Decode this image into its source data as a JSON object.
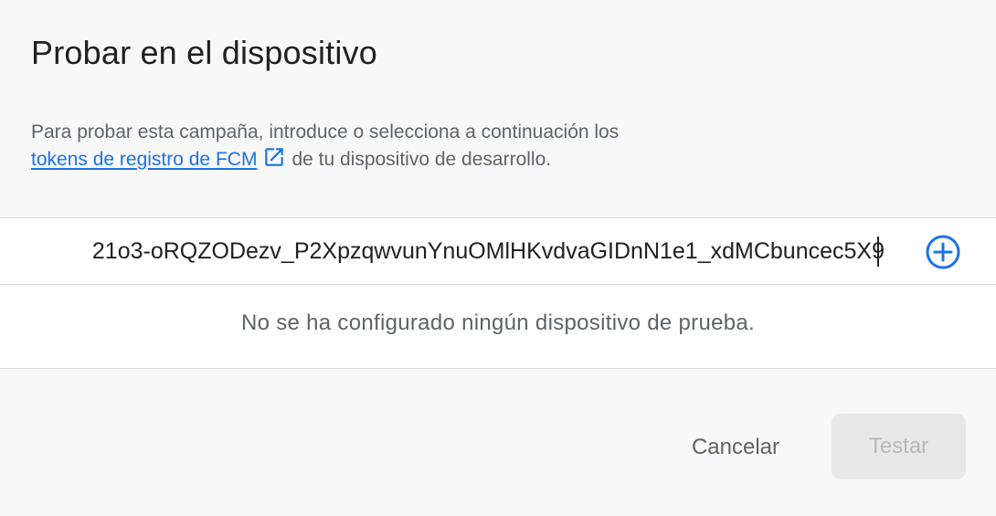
{
  "dialog": {
    "title": "Probar en el dispositivo",
    "description_before_link": "Para probar esta campaña, introduce o selecciona a continuación los",
    "link_text": "tokens de registro de FCM",
    "description_after_link": "de tu dispositivo de desarrollo.",
    "link_icon": "open-in-new-icon"
  },
  "token_field": {
    "visible_value": "21o3-oRQZODezv_P2XpzqwvunYnuOMlHKvdvaGIDnN1e1_xdMCbuncec5X9",
    "add_icon": "add-circle-icon"
  },
  "empty_state": {
    "message": "No se ha configurado ningún dispositivo de prueba."
  },
  "actions": {
    "cancel_label": "Cancelar",
    "test_label": "Testar",
    "test_disabled": true
  },
  "colors": {
    "link": "#1a73e8",
    "add_icon": "#1a73e8",
    "background": "#f8f8f8",
    "disabled_button_bg": "#e8e8e8"
  }
}
